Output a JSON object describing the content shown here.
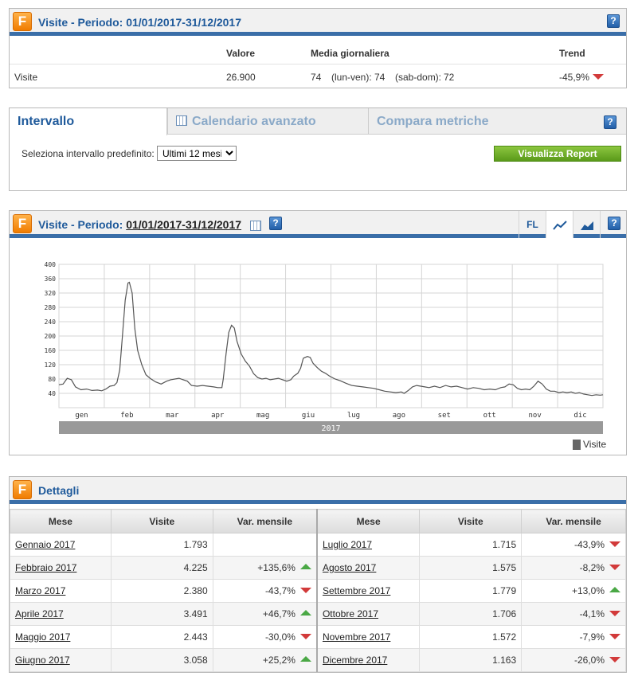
{
  "summary": {
    "title": "Visite - Periodo: 01/01/2017-31/12/2017",
    "help": "?",
    "headers": {
      "valore": "Valore",
      "media": "Media giornaliera",
      "trend": "Trend"
    },
    "row": {
      "label": "Visite",
      "valore": "26.900",
      "media_all": "74",
      "lunven_label": "(lun-ven):",
      "lunven": "74",
      "sabdom_label": "(sab-dom):",
      "sabdom": "72",
      "trend": "-45,9%"
    }
  },
  "interval": {
    "tabs": [
      "Intervallo",
      "Calendario avanzato",
      "Compara metriche"
    ],
    "select_label": "Seleziona intervallo predefinito:",
    "select_value": "Ultimi 12 mesi",
    "button": "Visualizza Report",
    "help": "?"
  },
  "chart_panel": {
    "title_prefix": "Visite - Periodo:",
    "title_period": "01/01/2017-31/12/2017",
    "toolbar": {
      "fl": "FL",
      "help": "?"
    },
    "year": "2017",
    "legend": "Visite",
    "colors": {
      "line": "#555555",
      "grid": "#d4d4d4",
      "year_bar": "#999999"
    }
  },
  "chart_data": {
    "type": "line",
    "x_ticks": [
      "gen",
      "feb",
      "mar",
      "apr",
      "mag",
      "giu",
      "lug",
      "ago",
      "set",
      "ott",
      "nov",
      "dic"
    ],
    "y_ticks": [
      40,
      80,
      120,
      160,
      200,
      240,
      280,
      320,
      360,
      400
    ],
    "ylim": [
      0,
      400
    ],
    "xlim": [
      0,
      365
    ],
    "grid": true,
    "legend_position": "bottom-right",
    "series": [
      {
        "name": "Visite",
        "points": [
          [
            0,
            64
          ],
          [
            3,
            66
          ],
          [
            6,
            82
          ],
          [
            9,
            78
          ],
          [
            12,
            58
          ],
          [
            16,
            50
          ],
          [
            20,
            52
          ],
          [
            24,
            48
          ],
          [
            28,
            49
          ],
          [
            31,
            47
          ],
          [
            34,
            52
          ],
          [
            37,
            60
          ],
          [
            40,
            62
          ],
          [
            42,
            70
          ],
          [
            44,
            105
          ],
          [
            46,
            200
          ],
          [
            48,
            300
          ],
          [
            50,
            348
          ],
          [
            51,
            350
          ],
          [
            53,
            320
          ],
          [
            55,
            220
          ],
          [
            57,
            160
          ],
          [
            60,
            120
          ],
          [
            63,
            92
          ],
          [
            66,
            82
          ],
          [
            70,
            72
          ],
          [
            74,
            66
          ],
          [
            78,
            74
          ],
          [
            81,
            78
          ],
          [
            84,
            80
          ],
          [
            87,
            82
          ],
          [
            90,
            78
          ],
          [
            93,
            74
          ],
          [
            96,
            62
          ],
          [
            100,
            60
          ],
          [
            104,
            62
          ],
          [
            108,
            60
          ],
          [
            112,
            58
          ],
          [
            115,
            56
          ],
          [
            118,
            56
          ],
          [
            119,
            80
          ],
          [
            121,
            150
          ],
          [
            123,
            210
          ],
          [
            125,
            230
          ],
          [
            127,
            222
          ],
          [
            129,
            185
          ],
          [
            132,
            150
          ],
          [
            135,
            130
          ],
          [
            138,
            116
          ],
          [
            141,
            95
          ],
          [
            144,
            84
          ],
          [
            147,
            80
          ],
          [
            150,
            82
          ],
          [
            153,
            78
          ],
          [
            156,
            80
          ],
          [
            159,
            82
          ],
          [
            162,
            78
          ],
          [
            165,
            74
          ],
          [
            168,
            78
          ],
          [
            170,
            88
          ],
          [
            173,
            96
          ],
          [
            175,
            110
          ],
          [
            177,
            138
          ],
          [
            180,
            143
          ],
          [
            182,
            140
          ],
          [
            184,
            124
          ],
          [
            187,
            112
          ],
          [
            190,
            102
          ],
          [
            193,
            96
          ],
          [
            196,
            88
          ],
          [
            200,
            80
          ],
          [
            204,
            75
          ],
          [
            208,
            68
          ],
          [
            212,
            62
          ],
          [
            216,
            60
          ],
          [
            220,
            58
          ],
          [
            224,
            56
          ],
          [
            228,
            54
          ],
          [
            232,
            50
          ],
          [
            236,
            46
          ],
          [
            240,
            44
          ],
          [
            244,
            42
          ],
          [
            248,
            44
          ],
          [
            250,
            40
          ],
          [
            253,
            48
          ],
          [
            256,
            58
          ],
          [
            259,
            62
          ],
          [
            262,
            60
          ],
          [
            265,
            58
          ],
          [
            268,
            56
          ],
          [
            272,
            60
          ],
          [
            276,
            56
          ],
          [
            280,
            62
          ],
          [
            284,
            58
          ],
          [
            288,
            60
          ],
          [
            292,
            56
          ],
          [
            296,
            52
          ],
          [
            300,
            56
          ],
          [
            304,
            54
          ],
          [
            308,
            50
          ],
          [
            312,
            52
          ],
          [
            316,
            50
          ],
          [
            320,
            56
          ],
          [
            323,
            58
          ],
          [
            326,
            66
          ],
          [
            329,
            64
          ],
          [
            332,
            54
          ],
          [
            335,
            50
          ],
          [
            338,
            52
          ],
          [
            341,
            50
          ],
          [
            344,
            60
          ],
          [
            347,
            74
          ],
          [
            350,
            66
          ],
          [
            353,
            52
          ],
          [
            356,
            46
          ],
          [
            359,
            46
          ],
          [
            362,
            42
          ],
          [
            365,
            44
          ],
          [
            368,
            42
          ],
          [
            371,
            44
          ],
          [
            374,
            40
          ],
          [
            377,
            42
          ],
          [
            380,
            38
          ],
          [
            383,
            36
          ],
          [
            386,
            34
          ],
          [
            389,
            36
          ],
          [
            392,
            35
          ],
          [
            394,
            36
          ]
        ]
      }
    ]
  },
  "details": {
    "title": "Dettagli",
    "headers": [
      "Mese",
      "Visite",
      "Var. mensile",
      "Mese",
      "Visite",
      "Var. mensile"
    ],
    "rows": [
      {
        "m1": "Gennaio 2017",
        "v1": "1.793",
        "c1": "",
        "d1": "none",
        "m2": "Luglio 2017",
        "v2": "1.715",
        "c2": "-43,9%",
        "d2": "down"
      },
      {
        "m1": "Febbraio 2017",
        "v1": "4.225",
        "c1": "+135,6%",
        "d1": "up",
        "m2": "Agosto 2017",
        "v2": "1.575",
        "c2": "-8,2%",
        "d2": "down"
      },
      {
        "m1": "Marzo 2017",
        "v1": "2.380",
        "c1": "-43,7%",
        "d1": "down",
        "m2": "Settembre 2017",
        "v2": "1.779",
        "c2": "+13,0%",
        "d2": "up"
      },
      {
        "m1": "Aprile 2017",
        "v1": "3.491",
        "c1": "+46,7%",
        "d1": "up",
        "m2": "Ottobre 2017",
        "v2": "1.706",
        "c2": "-4,1%",
        "d2": "down"
      },
      {
        "m1": "Maggio 2017",
        "v1": "2.443",
        "c1": "-30,0%",
        "d1": "down",
        "m2": "Novembre 2017",
        "v2": "1.572",
        "c2": "-7,9%",
        "d2": "down"
      },
      {
        "m1": "Giugno 2017",
        "v1": "3.058",
        "c1": "+25,2%",
        "d1": "up",
        "m2": "Dicembre 2017",
        "v2": "1.163",
        "c2": "-26,0%",
        "d2": "down"
      }
    ]
  }
}
